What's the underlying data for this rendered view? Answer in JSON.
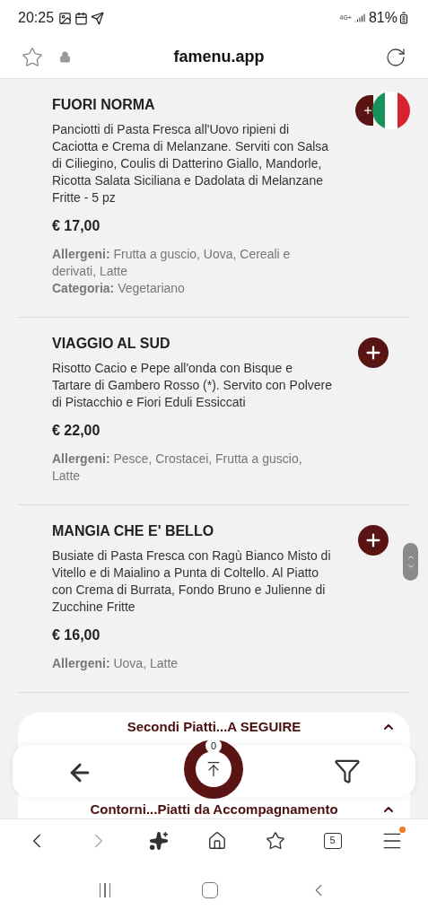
{
  "status_bar": {
    "time": "20:25",
    "network": "4G+",
    "battery": "81%"
  },
  "address_bar": {
    "url": "famenu.app"
  },
  "dishes": [
    {
      "name": "FUORI NORMA",
      "description": "Panciotti di Pasta Fresca all'Uovo ripieni di Caciotta e Crema di Melanzane. Serviti con Salsa di Ciliegino, Coulis di Datterino Giallo, Mandorle, Ricotta Salata Siciliana e Dadolata di Melanzane Fritte - 5 pz",
      "price": "€ 17,00",
      "details": [
        {
          "label": "Allergeni:",
          "value": "Frutta a guscio, Uova, Cereali e derivati, Latte"
        },
        {
          "label": "Categoria:",
          "value": "Vegetariano"
        }
      ]
    },
    {
      "name": "VIAGGIO AL SUD",
      "description": "Risotto Cacio e Pepe all'onda con Bisque e Tartare di Gambero Rosso (*). Servito con Polvere di Pistacchio e Fiori Eduli Essiccati",
      "price": "€ 22,00",
      "details": [
        {
          "label": "Allergeni:",
          "value": "Pesce, Crostacei, Frutta a guscio, Latte"
        }
      ]
    },
    {
      "name": "MANGIA CHE E' BELLO",
      "description": "Busiate di Pasta Fresca con Ragù Bianco Misto di Vitello e di Maialino a Punta di Coltello. Al Piatto con Crema di Burrata, Fondo Bruno e Julienne di Zucchine Fritte",
      "price": "€ 16,00",
      "details": [
        {
          "label": "Allergeni:",
          "value": "Uova, Latte"
        }
      ]
    }
  ],
  "sections": [
    {
      "title": "Secondi Piatti...A SEGUIRE",
      "expanded": false
    },
    {
      "title": "Contorni...Piatti da Accompagnamento",
      "expanded": false
    }
  ],
  "cart_count": "0",
  "tab_count": "5",
  "menu_notification": true
}
